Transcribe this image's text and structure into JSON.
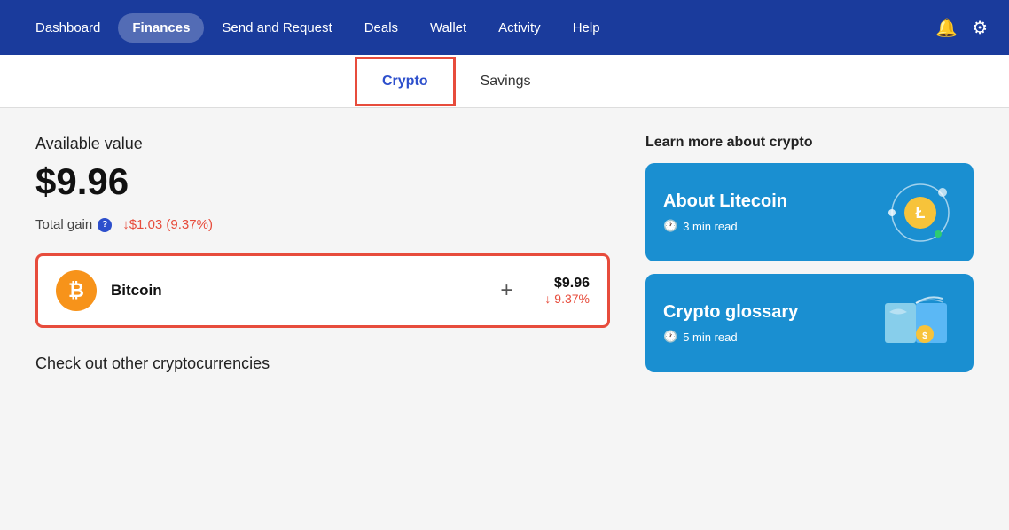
{
  "navbar": {
    "items": [
      {
        "label": "Dashboard",
        "active": false
      },
      {
        "label": "Finances",
        "active": true
      },
      {
        "label": "Send and Request",
        "active": false
      },
      {
        "label": "Deals",
        "active": false
      },
      {
        "label": "Wallet",
        "active": false
      },
      {
        "label": "Activity",
        "active": false
      },
      {
        "label": "Help",
        "active": false
      }
    ],
    "bell_icon": "🔔",
    "gear_icon": "⚙"
  },
  "subtabs": [
    {
      "label": "Crypto",
      "active": true
    },
    {
      "label": "Savings",
      "active": false
    }
  ],
  "main": {
    "available_label": "Available value",
    "available_value": "$9.96",
    "total_gain_label": "Total gain",
    "total_gain_value": "↓$1.03 (9.37%)",
    "crypto_row": {
      "name": "Bitcoin",
      "usd": "$9.96",
      "pct": "↓ 9.37%",
      "plus": "+"
    },
    "check_other": "Check out other cryptocurrencies"
  },
  "right": {
    "learn_label": "Learn more about crypto",
    "cards": [
      {
        "title": "About Litecoin",
        "time": "3 min read"
      },
      {
        "title": "Crypto glossary",
        "time": "5 min read"
      }
    ]
  }
}
